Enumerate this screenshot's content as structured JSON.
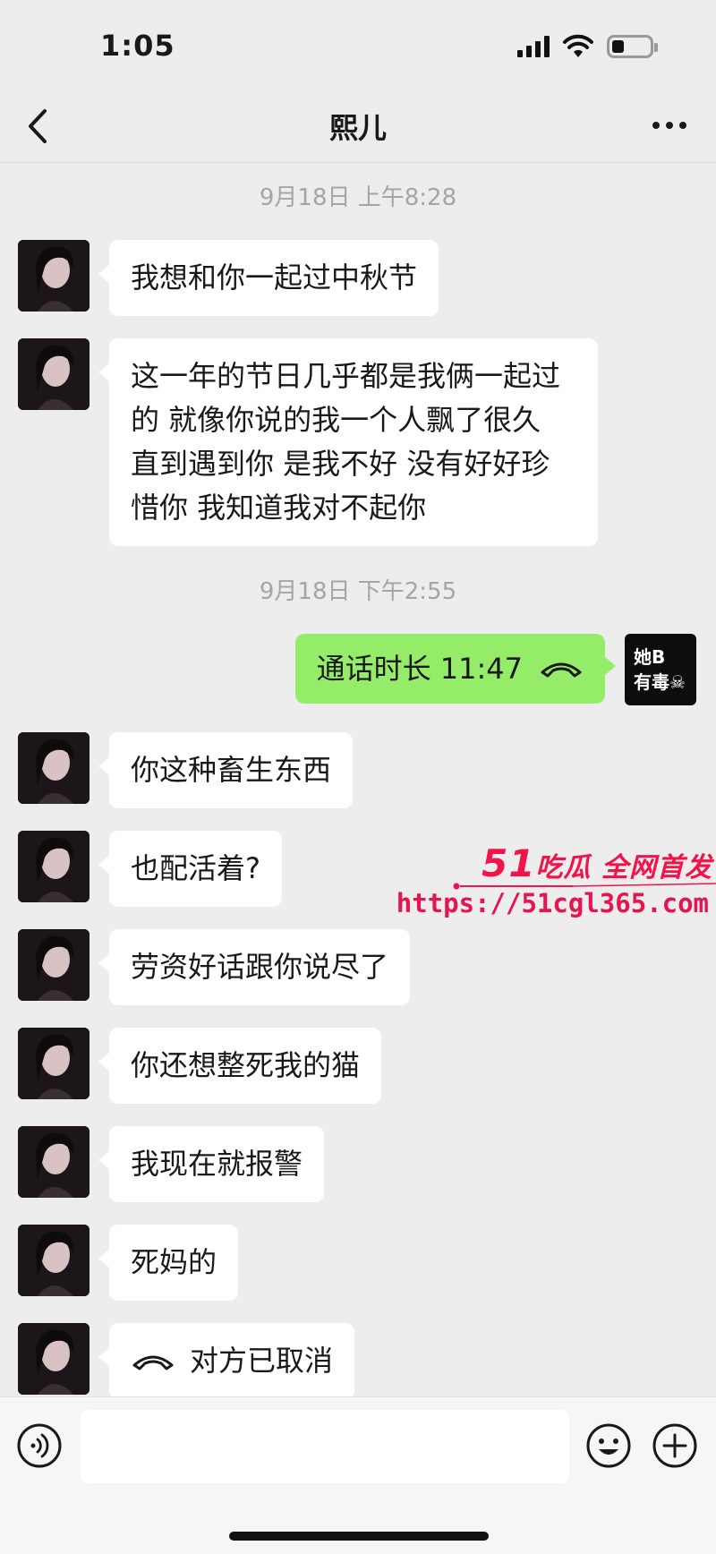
{
  "status_bar": {
    "time": "1:05"
  },
  "header": {
    "title": "熙儿"
  },
  "timestamps": [
    "9月18日 上午8:28",
    "9月18日 下午2:55"
  ],
  "messages": {
    "m1": "我想和你一起过中秋节",
    "m2": "这一年的节日几乎都是我俩一起过的 就像你说的我一个人飘了很久 直到遇到你 是我不好 没有好好珍惜你 我知道我对不起你",
    "self_call": "通话时长 11:47",
    "m3": "你这种畜生东西",
    "m4": "也配活着?",
    "m5": "劳资好话跟你说尽了",
    "m6": "你还想整死我的猫",
    "m7": "我现在就报警",
    "m8": "死妈的",
    "m9_call": "对方已取消"
  },
  "self_avatar": {
    "line1": "她B",
    "line2": "有毒☠"
  },
  "watermark": {
    "num": "51",
    "brand": "吃瓜 全网首发",
    "url": "https://51cgl365.com"
  },
  "input": {
    "placeholder": ""
  },
  "colors": {
    "background": "#ededed",
    "self_bubble": "#95ec69",
    "other_bubble": "#ffffff",
    "watermark": "#f0144a"
  }
}
